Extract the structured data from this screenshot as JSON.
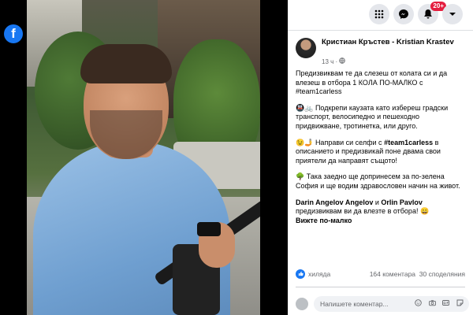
{
  "viewer": {
    "logo_glyph": "f"
  },
  "topbar": {
    "notifications_badge": "20+",
    "icons": [
      "menu-grid-icon",
      "messenger-icon",
      "bell-icon",
      "chevron-down-icon"
    ]
  },
  "post": {
    "author": "Кристиан Кръстев - Kristian Krastev",
    "time": "13 ч",
    "privacy_icon": "globe-icon",
    "paragraphs": [
      "Предизвиквам те да слезеш от колата си и да влезеш в отбора 1 КОЛА ПО-МАЛКО с #team1carless",
      "Подкрепи каузата като избереш градски транспорт, велосипедно и пешеходно придвижване, тротинетка, или друго.",
      "Направи си селфи с #team1carless в описанието и предизвикай поне двама свои приятели да направят същото!",
      "Така заедно ще допринесем за по-зелена София и ще водим здравословен начин на живот."
    ],
    "p2_emoji": "🚇🚲",
    "p3_emoji": "😉🤳",
    "p3_hashtag": "#team1carless",
    "p3_before": "Направи си селфи с ",
    "p3_after": " в описанието и предизвикай поне двама свои приятели да направят същото!",
    "p4_emoji": "🌳",
    "tag1": "Darin Angelov Angelov",
    "and": " и ",
    "tag2": "Orlin Pavlov",
    "tag_rest": " предизвиквам ви да влезте в отбора! 😀",
    "see_less": "Вижте по-малко"
  },
  "reactions": {
    "likes": "хиляда",
    "comments": "164 коментара",
    "shares": "30 споделяния"
  },
  "comment": {
    "placeholder": "Напишете коментар...",
    "icons": [
      "emoji-icon",
      "camera-icon",
      "gif-icon",
      "sticker-icon"
    ]
  },
  "colors": {
    "brand": "#1877f2",
    "badge": "#e41e3f",
    "secondary_text": "#65676b"
  }
}
